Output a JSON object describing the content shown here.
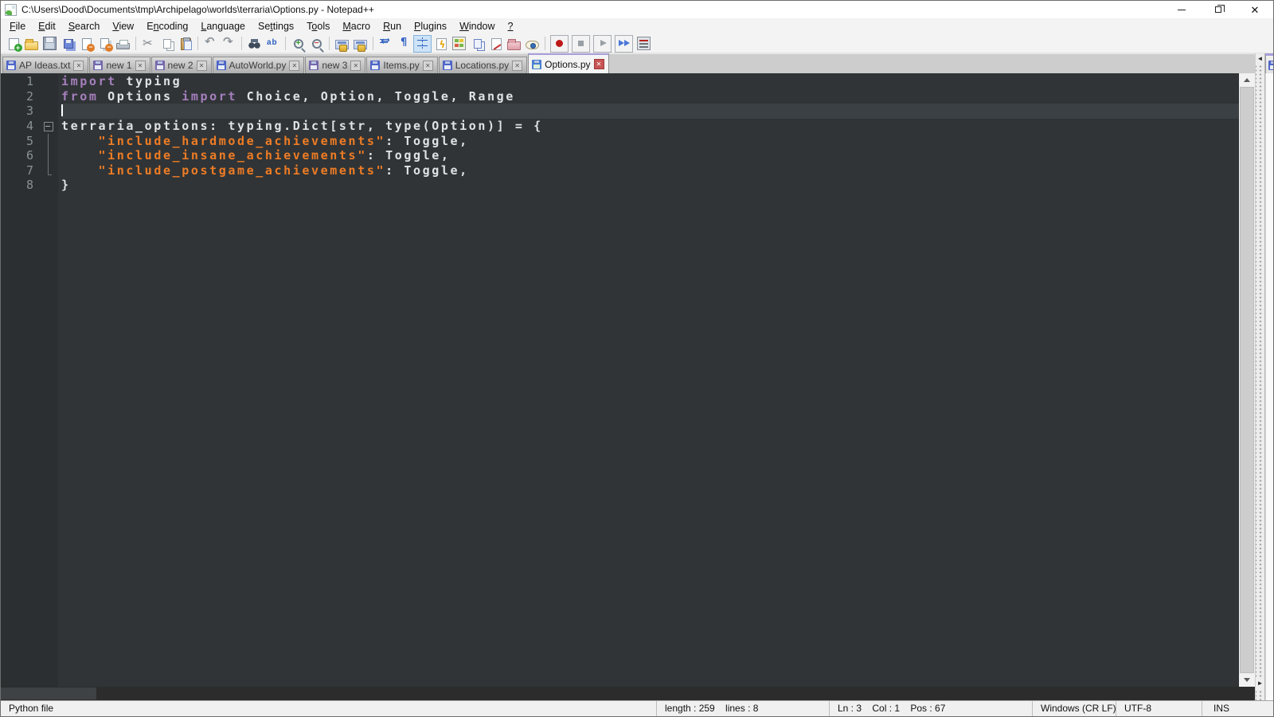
{
  "window": {
    "title": "C:\\Users\\Dood\\Documents\\tmp\\Archipelago\\worlds\\terraria\\Options.py - Notepad++",
    "controls": [
      "minimize",
      "restore",
      "close"
    ]
  },
  "menu": {
    "items": [
      {
        "label": "File",
        "u": 0
      },
      {
        "label": "Edit",
        "u": 0
      },
      {
        "label": "Search",
        "u": 0
      },
      {
        "label": "View",
        "u": 0
      },
      {
        "label": "Encoding",
        "u": 1
      },
      {
        "label": "Language",
        "u": 0
      },
      {
        "label": "Settings",
        "u": 2
      },
      {
        "label": "Tools",
        "u": 1
      },
      {
        "label": "Macro",
        "u": 0
      },
      {
        "label": "Run",
        "u": 0
      },
      {
        "label": "Plugins",
        "u": 0
      },
      {
        "label": "Window",
        "u": 0
      },
      {
        "label": "?",
        "u": 0
      }
    ]
  },
  "toolbar": {
    "buttons": [
      {
        "name": "new-file"
      },
      {
        "name": "open"
      },
      {
        "name": "save"
      },
      {
        "name": "save-all"
      },
      {
        "name": "close"
      },
      {
        "name": "close-all"
      },
      {
        "name": "print"
      },
      {
        "sep": true
      },
      {
        "name": "cut"
      },
      {
        "name": "copy"
      },
      {
        "name": "paste"
      },
      {
        "sep": true
      },
      {
        "name": "undo"
      },
      {
        "name": "redo"
      },
      {
        "sep": true
      },
      {
        "name": "find"
      },
      {
        "name": "replace"
      },
      {
        "sep": true
      },
      {
        "name": "zoom-in"
      },
      {
        "name": "zoom-out"
      },
      {
        "sep": true
      },
      {
        "name": "sync-vertical"
      },
      {
        "name": "sync-horizontal"
      },
      {
        "sep": true
      },
      {
        "name": "word-wrap"
      },
      {
        "name": "show-all-characters"
      },
      {
        "name": "show-indent-guide",
        "active": true
      },
      {
        "name": "user-defined-dialog"
      },
      {
        "name": "document-map"
      },
      {
        "name": "document-list"
      },
      {
        "name": "function-list"
      },
      {
        "name": "folder-as-workspace"
      },
      {
        "name": "monitoring"
      },
      {
        "sep": true
      },
      {
        "name": "macro-record",
        "boxed": true
      },
      {
        "name": "macro-stop",
        "boxed": true
      },
      {
        "name": "macro-play",
        "boxed": true
      },
      {
        "name": "macro-run-multiple",
        "boxed": true
      },
      {
        "name": "macro-save"
      }
    ]
  },
  "tabs": [
    {
      "label": "AP Ideas.txt",
      "saved": true,
      "active": false
    },
    {
      "label": "new 1",
      "saved": false,
      "active": false
    },
    {
      "label": "new 2",
      "saved": false,
      "active": false
    },
    {
      "label": "AutoWorld.py",
      "saved": true,
      "active": false
    },
    {
      "label": "new 3",
      "saved": false,
      "active": false
    },
    {
      "label": "Items.py",
      "saved": true,
      "active": false
    },
    {
      "label": "Locations.py",
      "saved": true,
      "active": false
    },
    {
      "label": "Options.py",
      "saved": true,
      "active": true
    }
  ],
  "tab_close_glyph": "✕",
  "editor": {
    "colors": {
      "background": "#303436",
      "gutter_background": "#2b2f31",
      "line_number": "#8a9294",
      "current_line": "#3a4043",
      "keyword": "#a57fbd",
      "string": "#ee7c25",
      "default_text": "#e0e2e4"
    },
    "lines": [
      {
        "n": 1,
        "fold": "",
        "current": false,
        "caret": false,
        "seg": [
          [
            "kw",
            "import"
          ],
          [
            "df",
            " typing"
          ]
        ]
      },
      {
        "n": 2,
        "fold": "",
        "current": false,
        "caret": false,
        "seg": [
          [
            "kw",
            "from"
          ],
          [
            "df",
            " Options "
          ],
          [
            "kw",
            "import"
          ],
          [
            "df",
            " Choice, Option, Toggle, Range"
          ]
        ]
      },
      {
        "n": 3,
        "fold": "",
        "current": true,
        "caret": true,
        "seg": []
      },
      {
        "n": 4,
        "fold": "box",
        "current": false,
        "caret": false,
        "seg": [
          [
            "df",
            "terraria_options: typing.Dict[str, type(Option)] = {"
          ]
        ]
      },
      {
        "n": 5,
        "fold": "line",
        "current": false,
        "caret": false,
        "seg": [
          [
            "df",
            "    "
          ],
          [
            "st",
            "\"include_hardmode_achievements\""
          ],
          [
            "df",
            ": Toggle,"
          ]
        ]
      },
      {
        "n": 6,
        "fold": "line",
        "current": false,
        "caret": false,
        "seg": [
          [
            "df",
            "    "
          ],
          [
            "st",
            "\"include_insane_achievements\""
          ],
          [
            "df",
            ": Toggle,"
          ]
        ]
      },
      {
        "n": 7,
        "fold": "end",
        "current": false,
        "caret": false,
        "seg": [
          [
            "df",
            "    "
          ],
          [
            "st",
            "\"include_postgame_achievements\""
          ],
          [
            "df",
            ": Toggle,"
          ]
        ]
      },
      {
        "n": 8,
        "fold": "",
        "current": false,
        "caret": false,
        "seg": [
          [
            "df",
            "}"
          ]
        ]
      }
    ]
  },
  "splitter": {
    "collapse_left_glyph": "◄",
    "collapse_right_glyph": "►"
  },
  "status": {
    "sections": [
      {
        "name": "doc-type",
        "text": "Python file",
        "interactable": false
      },
      {
        "name": "length-lines",
        "text": "length : 259    lines : 8",
        "interactable": false
      },
      {
        "name": "cursor-position",
        "text": "Ln : 3    Col : 1    Pos : 67",
        "interactable": false
      },
      {
        "name": "eol-format",
        "text": "Windows (CR LF)",
        "interactable": true
      },
      {
        "name": "encoding",
        "text": "UTF-8",
        "interactable": true
      },
      {
        "name": "insert-mode",
        "text": "INS",
        "interactable": true
      }
    ]
  }
}
